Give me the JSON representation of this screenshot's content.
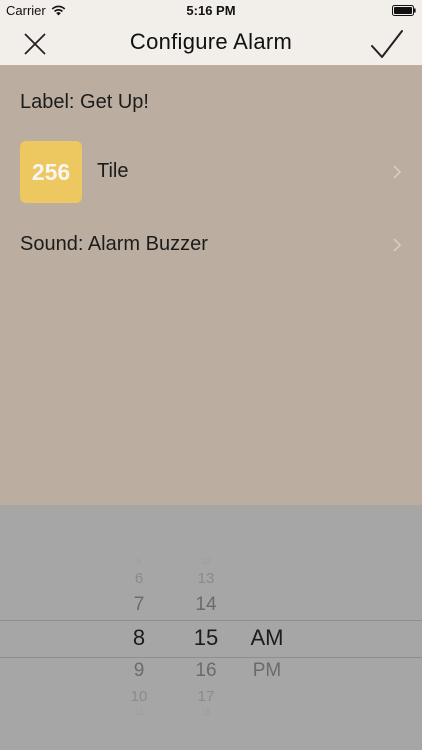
{
  "status_bar": {
    "carrier": "Carrier",
    "time": "5:16 PM"
  },
  "nav": {
    "title": "Configure Alarm",
    "close_icon": "close-icon",
    "done_icon": "checkmark-icon"
  },
  "rows": {
    "label_text": "Label: Get Up!",
    "tile_value": "256",
    "tile_label": "Tile",
    "tile_color": "#edc75f",
    "sound_text": "Sound: Alarm Buzzer"
  },
  "picker": {
    "hours": [
      "5",
      "6",
      "7",
      "8",
      "9",
      "10",
      "11"
    ],
    "minutes": [
      "12",
      "13",
      "14",
      "15",
      "16",
      "17",
      "18"
    ],
    "ampm": [
      "AM",
      "PM"
    ],
    "selected_hour": "8",
    "selected_minute": "15",
    "selected_ampm": "AM"
  },
  "colors": {
    "nav_background": "#f2eee9",
    "content_background": "#bbaea0",
    "picker_background": "#a6a6a6"
  }
}
